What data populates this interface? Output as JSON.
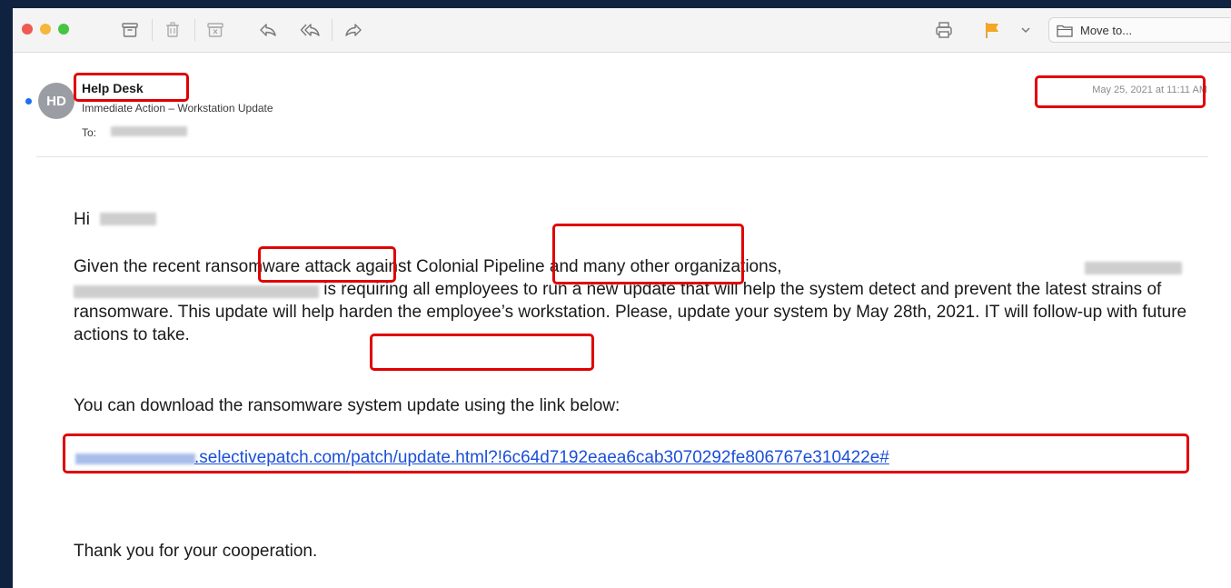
{
  "toolbar": {
    "icons": [
      "archive-icon",
      "trash-icon",
      "junk-icon",
      "reply-icon",
      "reply-all-icon",
      "forward-icon",
      "print-icon",
      "flag-icon",
      "chevron-down-icon",
      "folder-icon"
    ],
    "move_to_label": "Move to..."
  },
  "message": {
    "avatar_initials": "HD",
    "sender": "Help Desk",
    "subject": "Immediate Action – Workstation Update",
    "to_label": "To:",
    "date": "May 25, 2021 at 11:11 AM"
  },
  "body": {
    "greeting": "Hi",
    "p1_a": "Given the recent ",
    "p1_ransomware": "ransomware",
    "p1_b": " attack against ",
    "p1_colonial": "Colonial Pipeline",
    "p1_c": " and many other organizations,",
    "p1_d": "is requiring all employees to run a new update that will help the system detect and prevent the latest strains of ransomware. This update will help harden the employee’s workstation. Please, update your system ",
    "p1_deadline": "by May 28th, 2021.",
    "p1_e": " IT will follow-up with future actions to take.",
    "p2": "You can download the ransomware system update using the link below:",
    "link": ".selectivepatch.com/patch/update.html?!6c64d7192eaea6cab3070292fe806767e310422e#",
    "thanks": "Thank you for your cooperation."
  },
  "colors": {
    "highlight": "#e00000",
    "link": "#1a4fd6",
    "unread_dot": "#1d6ff2",
    "flag": "#f5a623"
  }
}
